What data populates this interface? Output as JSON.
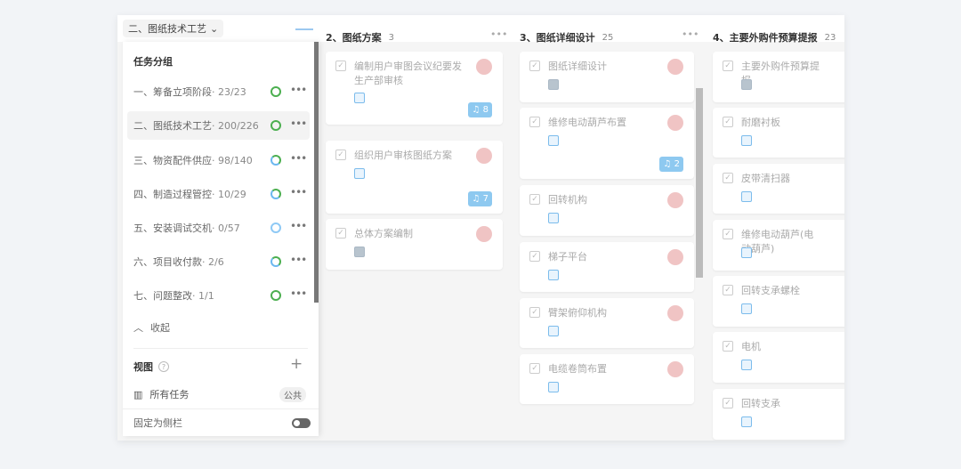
{
  "header": {
    "group_select": "二、图纸技术工艺"
  },
  "sidebar": {
    "title": "任务分组",
    "groups": [
      {
        "label": "一、筹备立项阶段",
        "count": "· 23/23",
        "ring": "green"
      },
      {
        "label": "二、图纸技术工艺",
        "count": "· 200/226",
        "ring": "green",
        "active": true
      },
      {
        "label": "三、物资配件供应",
        "count": "· 98/140",
        "ring": "mixed"
      },
      {
        "label": "四、制造过程管控",
        "count": "· 10/29",
        "ring": "mixed"
      },
      {
        "label": "五、安装调试交机",
        "count": "· 0/57",
        "ring": "blue"
      },
      {
        "label": "六、项目收付款",
        "count": "· 2/6",
        "ring": "mixed"
      },
      {
        "label": "七、问题整改",
        "count": "· 1/1",
        "ring": "green"
      }
    ],
    "collapse": "收起",
    "views_title": "视图",
    "view_all": "所有任务",
    "view_badge": "公共",
    "pin": "固定为侧栏",
    "pin_on": false
  },
  "columns": [
    {
      "title": "2、图纸方案",
      "count": "3",
      "cards": [
        {
          "title": "编制用户审图会议纪要发生产部审核",
          "icon": "blue",
          "badge": "8"
        },
        {
          "title": "组织用户审核图纸方案",
          "icon": "blue",
          "badge": "7"
        },
        {
          "title": "总体方案编制",
          "icon": "gray"
        }
      ]
    },
    {
      "title": "3、图纸详细设计",
      "count": "25",
      "cards": [
        {
          "title": "图纸详细设计",
          "icon": "gray"
        },
        {
          "title": "维修电动葫芦布置",
          "icon": "blue",
          "badge": "2"
        },
        {
          "title": "回转机构",
          "icon": "blue"
        },
        {
          "title": "梯子平台",
          "icon": "blue"
        },
        {
          "title": "臂架俯仰机构",
          "icon": "blue"
        },
        {
          "title": "电缆卷筒布置",
          "icon": "blue"
        }
      ]
    },
    {
      "title": "4、主要外购件预算提报",
      "count": "23",
      "cards": [
        {
          "title": "主要外购件预算提报",
          "icon": "gray"
        },
        {
          "title": "耐磨衬板",
          "icon": "blue"
        },
        {
          "title": "皮带清扫器",
          "icon": "blue"
        },
        {
          "title": "维修电动葫芦(电动葫芦)",
          "icon": "blue"
        },
        {
          "title": "回转支承螺栓",
          "icon": "blue"
        },
        {
          "title": "电机",
          "icon": "blue"
        },
        {
          "title": "回转支承",
          "icon": "blue"
        }
      ]
    }
  ],
  "colors": {
    "accent": "#8ec9f0",
    "avatar": "#f0c4c4",
    "progress_green": "#4caf50"
  }
}
